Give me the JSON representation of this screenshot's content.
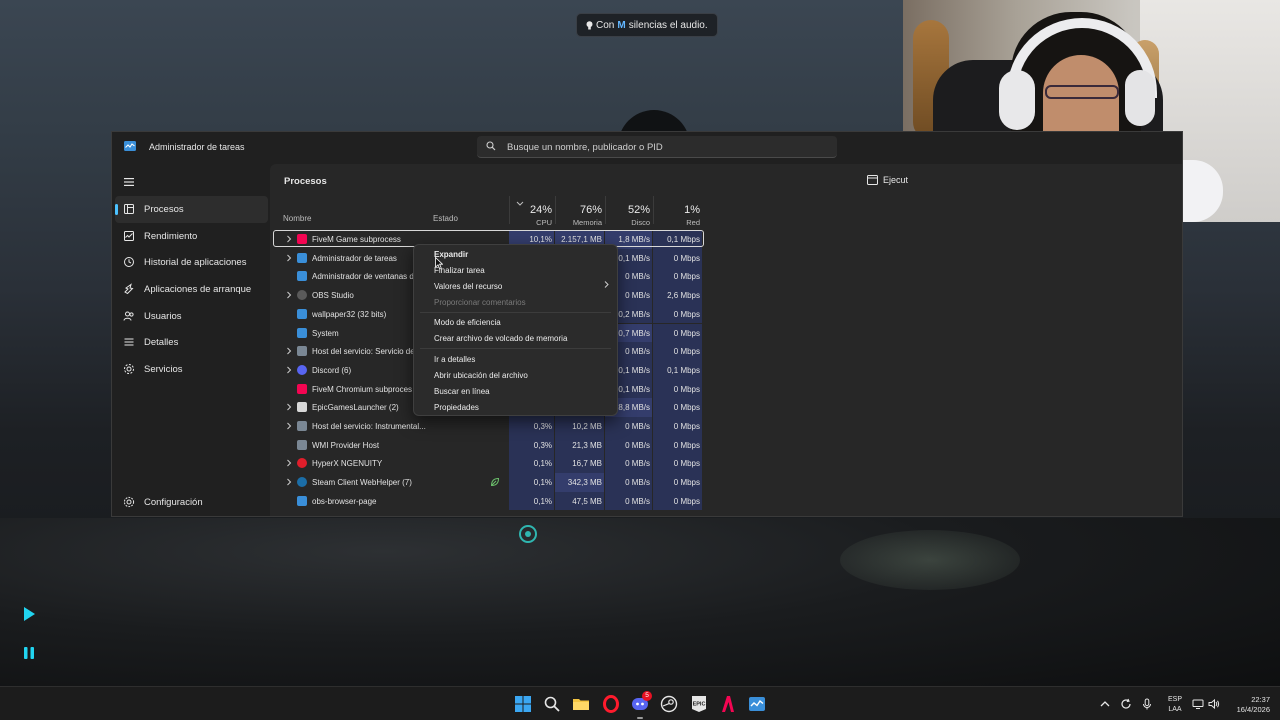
{
  "toast": {
    "prefix": "Con",
    "key": "M",
    "suffix": "silencias el audio."
  },
  "window": {
    "title": "Administrador de tareas",
    "search_placeholder": "Busque un nombre, publicador o PID",
    "run_task_label": "Ejecut"
  },
  "sidebar": {
    "items": [
      {
        "label": "Procesos",
        "icon": "processes-icon",
        "active": true
      },
      {
        "label": "Rendimiento",
        "icon": "performance-icon"
      },
      {
        "label": "Historial de aplicaciones",
        "icon": "app-history-icon"
      },
      {
        "label": "Aplicaciones de arranque",
        "icon": "startup-apps-icon"
      },
      {
        "label": "Usuarios",
        "icon": "users-icon"
      },
      {
        "label": "Detalles",
        "icon": "details-icon"
      },
      {
        "label": "Servicios",
        "icon": "services-icon"
      }
    ],
    "settings_label": "Configuración"
  },
  "page_title": "Procesos",
  "columns": {
    "name": "Nombre",
    "status": "Estado",
    "cpu": {
      "pct": "24%",
      "label": "CPU"
    },
    "memory": {
      "pct": "76%",
      "label": "Memoria"
    },
    "disk": {
      "pct": "52%",
      "label": "Disco"
    },
    "network": {
      "pct": "1%",
      "label": "Red"
    }
  },
  "processes": [
    {
      "name": "FiveM Game subprocess",
      "expand": true,
      "icon": "fivem-icon",
      "cpu": "10,1%",
      "mem": "2.157,1 MB",
      "disk": "1,8 MB/s",
      "net": "0,1 Mbps",
      "selected": true
    },
    {
      "name": "Administrador de tareas",
      "expand": true,
      "icon": "task-manager-icon",
      "cpu": "",
      "mem": "",
      "disk": "0,1 MB/s",
      "net": "0 Mbps"
    },
    {
      "name": "Administrador de ventanas d",
      "expand": false,
      "icon": "window-manager-icon",
      "cpu": "",
      "mem": "",
      "disk": "0 MB/s",
      "net": "0 Mbps"
    },
    {
      "name": "OBS Studio",
      "expand": true,
      "icon": "obs-icon",
      "cpu": "",
      "mem": "",
      "disk": "0 MB/s",
      "net": "2,6 Mbps"
    },
    {
      "name": "wallpaper32 (32 bits)",
      "expand": false,
      "icon": "wallpaper-icon",
      "cpu": "",
      "mem": "",
      "disk": "0,2 MB/s",
      "net": "0 Mbps"
    },
    {
      "name": "System",
      "expand": false,
      "icon": "system-icon",
      "cpu": "",
      "mem": "",
      "disk": "0,7 MB/s",
      "net": "0 Mbps"
    },
    {
      "name": "Host del servicio: Servicio de",
      "expand": true,
      "icon": "service-host-icon",
      "cpu": "",
      "mem": "",
      "disk": "0 MB/s",
      "net": "0 Mbps"
    },
    {
      "name": "Discord (6)",
      "expand": true,
      "icon": "discord-icon",
      "cpu": "",
      "mem": "",
      "disk": "0,1 MB/s",
      "net": "0,1 Mbps"
    },
    {
      "name": "FiveM Chromium subproces",
      "expand": false,
      "icon": "fivem-icon",
      "cpu": "",
      "mem": "",
      "disk": "0,1 MB/s",
      "net": "0 Mbps"
    },
    {
      "name": "EpicGamesLauncher (2)",
      "expand": true,
      "icon": "epic-games-icon",
      "cpu": "",
      "mem": "",
      "disk": "18,8 MB/s",
      "net": "0 Mbps"
    },
    {
      "name": "Host del servicio: Instrumental...",
      "expand": true,
      "icon": "service-host-icon",
      "cpu": "0,3%",
      "mem": "10,2 MB",
      "disk": "0 MB/s",
      "net": "0 Mbps"
    },
    {
      "name": "WMI Provider Host",
      "expand": false,
      "icon": "wmi-icon",
      "cpu": "0,3%",
      "mem": "21,3 MB",
      "disk": "0 MB/s",
      "net": "0 Mbps"
    },
    {
      "name": "HyperX NGENUITY",
      "expand": true,
      "icon": "hyperx-icon",
      "cpu": "0,1%",
      "mem": "16,7 MB",
      "disk": "0 MB/s",
      "net": "0 Mbps"
    },
    {
      "name": "Steam Client WebHelper (7)",
      "expand": true,
      "icon": "steam-icon",
      "cpu": "0,1%",
      "mem": "342,3 MB",
      "disk": "0 MB/s",
      "net": "0 Mbps",
      "status_icon": true
    },
    {
      "name": "obs-browser-page",
      "expand": false,
      "icon": "obs-browser-icon",
      "cpu": "0,1%",
      "mem": "47,5 MB",
      "disk": "0 MB/s",
      "net": "0 Mbps"
    }
  ],
  "context_menu": {
    "items": [
      {
        "label": "Expandir",
        "bold": true
      },
      {
        "label": "Finalizar tarea"
      },
      {
        "label": "Valores del recurso",
        "submenu": true
      },
      {
        "label": "Proporcionar comentarios",
        "disabled": true
      },
      {
        "label": "Modo de eficiencia"
      },
      {
        "label": "Crear archivo de volcado de memoria"
      },
      {
        "label": "Ir a detalles"
      },
      {
        "label": "Abrir ubicación del archivo"
      },
      {
        "label": "Buscar en línea"
      },
      {
        "label": "Propiedades"
      }
    ]
  },
  "taskbar": {
    "icons": [
      "windows-start-icon",
      "search-icon",
      "file-explorer-icon",
      "opera-icon",
      "discord-icon",
      "steam-icon",
      "epic-games-icon",
      "fivem-icon",
      "task-manager-icon"
    ],
    "discord_badge": "5",
    "lang_top": "ESP",
    "lang_bottom": "LAA",
    "time": "22:37",
    "date": "16/4/2026"
  },
  "colors": {
    "accent": "#4cc2ff",
    "window_bg": "#202020",
    "content_bg": "#272727",
    "heat_light": "#2a3256",
    "heat_mid": "#343d6c"
  }
}
